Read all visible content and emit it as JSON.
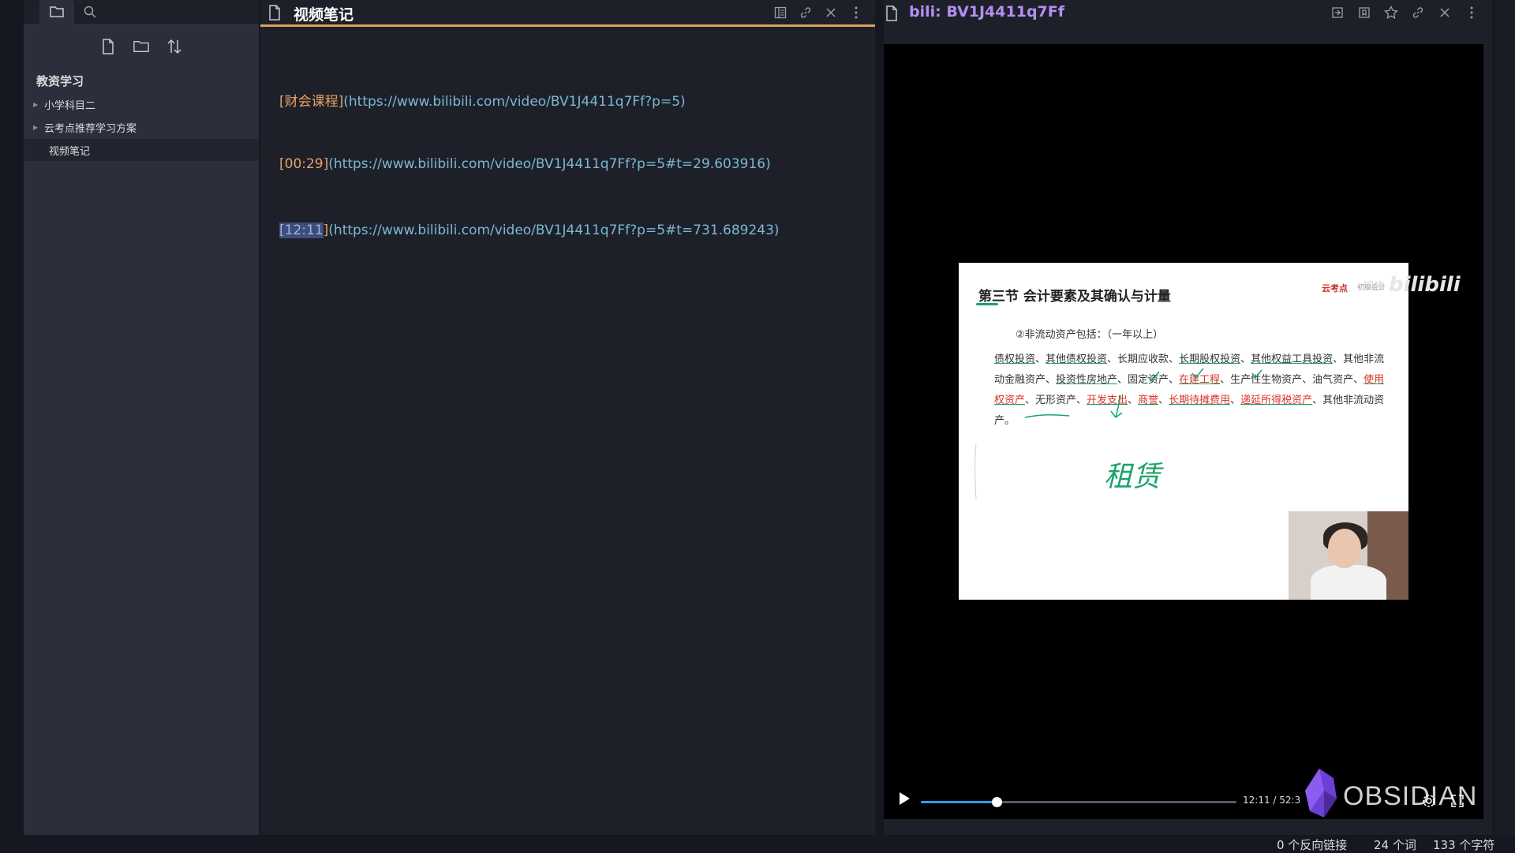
{
  "sidebar": {
    "vault_title": "教资学习",
    "items": [
      {
        "label": "小学科目二",
        "type": "folder"
      },
      {
        "label": "云考点推荐学习方案",
        "type": "folder"
      },
      {
        "label": "视频笔记",
        "type": "file"
      }
    ]
  },
  "editor": {
    "tab_title": "视频笔记",
    "lines": [
      {
        "text": "[财会课程]",
        "url": "(https://www.bilibili.com/video/BV1J4411q7Ff?p=5)"
      },
      {
        "text": "[00:29]",
        "url": "(https://www.bilibili.com/video/BV1J4411q7Ff?p=5#t=29.603916)"
      },
      {
        "open": "[",
        "selected": "12:11",
        "close": "]",
        "url": "(https://www.bilibili.com/video/BV1J4411q7Ff?p=5#t=731.689243)"
      }
    ]
  },
  "viewer": {
    "tab_title": "bili: BV1J4411q7Ff",
    "slide": {
      "title": "第三节 会计要素及其确认与计量",
      "logo": "云考点",
      "logo_sub": "初级会计",
      "subtitle": "②非流动资产包括：（一年以上）",
      "body": [
        {
          "t": "债权投资",
          "u": true
        },
        {
          "t": "、"
        },
        {
          "t": "其他债权投资",
          "u": true
        },
        {
          "t": "、长期应收款、"
        },
        {
          "t": "长期股权投资",
          "u": true
        },
        {
          "t": "、"
        },
        {
          "t": "其他权益工具投资",
          "u": true
        },
        {
          "t": "、其他非流动金融资产、"
        },
        {
          "t": "投资性房地产",
          "u": true
        },
        {
          "t": "、固定资产、"
        },
        {
          "t": "在建工程",
          "red": true
        },
        {
          "t": "、生产性生物资产、油气资产、"
        },
        {
          "t": "使用权资产",
          "red": true
        },
        {
          "t": "、无形资产、"
        },
        {
          "t": "开发支出",
          "red": true
        },
        {
          "t": "、"
        },
        {
          "t": "商誉",
          "red": true
        },
        {
          "t": "、"
        },
        {
          "t": "长期待摊费用",
          "red": true
        },
        {
          "t": "、"
        },
        {
          "t": "递延所得税资产",
          "red": true
        },
        {
          "t": "、其他非流动资产。"
        }
      ],
      "handwriting": "租赁"
    },
    "watermark": "bilibili",
    "watermark_prefix": "网校",
    "player": {
      "time": "12:11 / 52:3",
      "progress": 0.24,
      "overlay_logo": "OBSIDIAN"
    }
  },
  "status": {
    "backlinks": "0 个反向链接",
    "words": "24 个词",
    "chars": "133 个字符"
  },
  "colors": {
    "accent_tab": "#d8a657",
    "link_text": "#e8a263",
    "link_url": "#7bb8d4",
    "viewer_title": "#b48ef5",
    "progress": "#2f9fe8"
  }
}
